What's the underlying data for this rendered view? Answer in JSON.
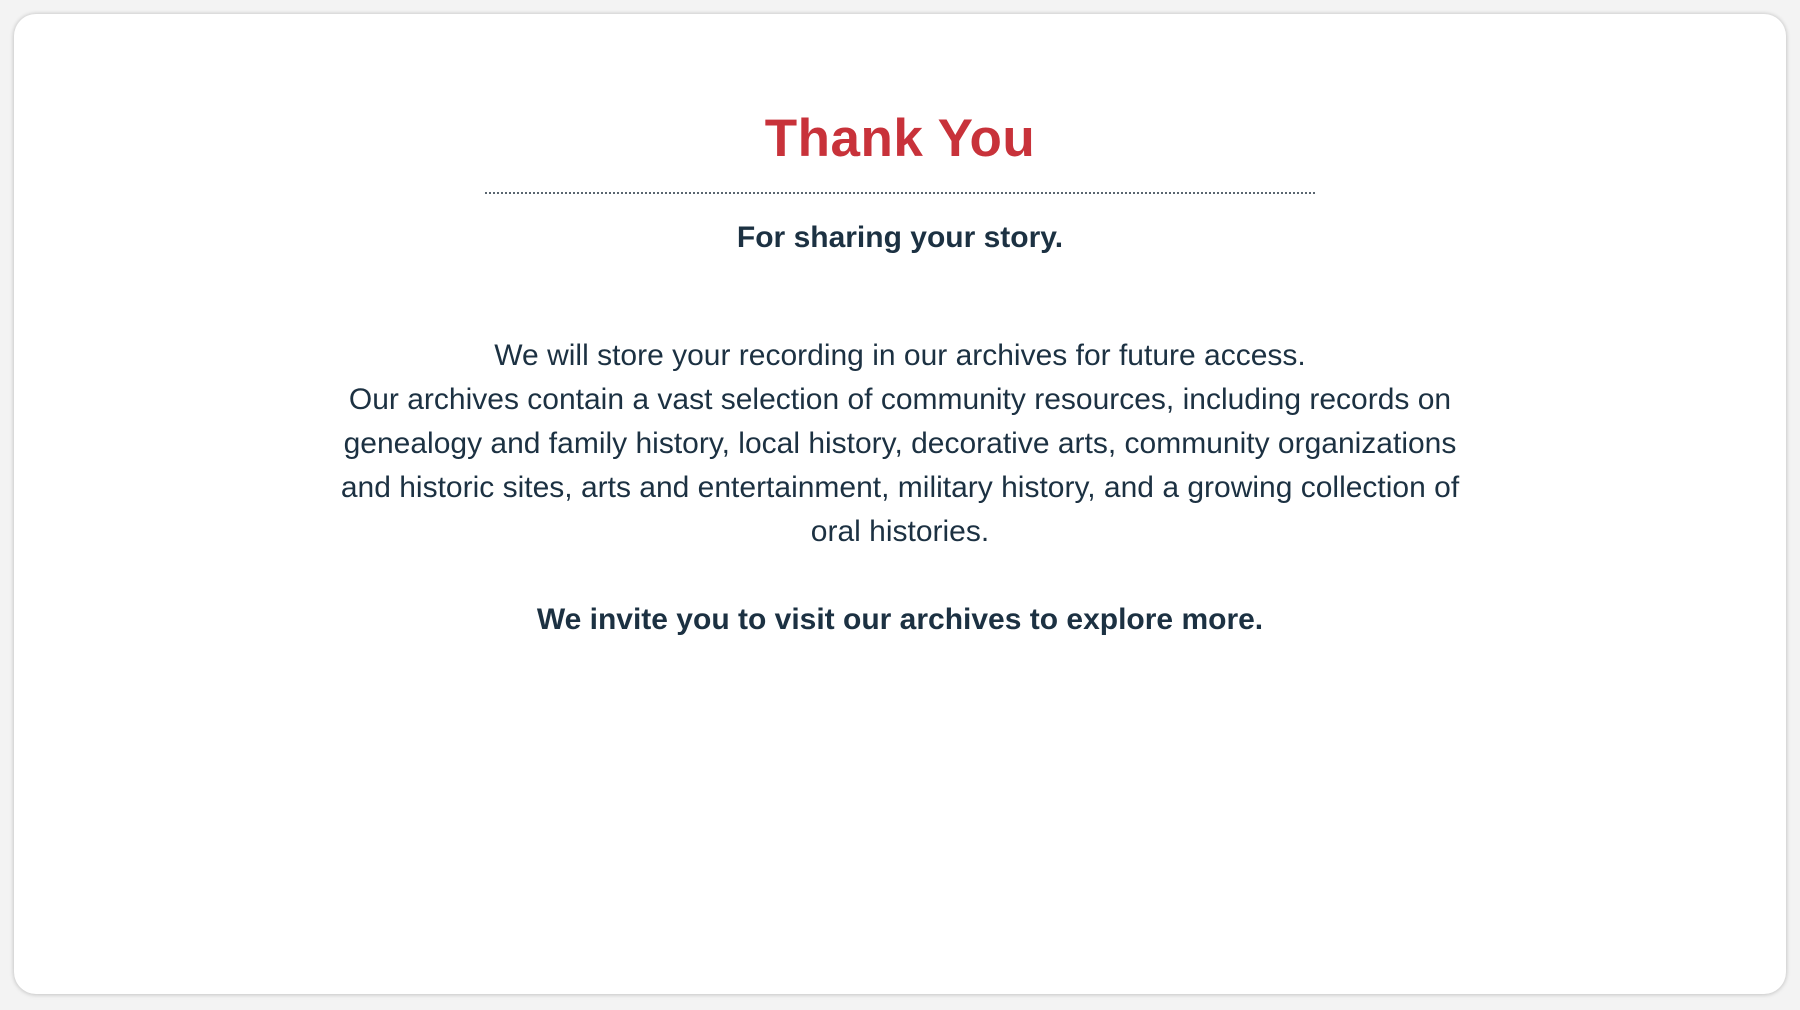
{
  "thank_you": {
    "title": "Thank You",
    "subtitle": "For sharing your story.",
    "body_line_1": "We will store your recording in our archives for future access.",
    "body_line_2": "Our archives contain a vast selection of community resources, including records on genealogy and family history, local history, decorative arts, community organizations and historic sites, arts and entertainment, military history, and a growing collection of oral histories.",
    "invite": "We invite you to visit our archives to explore more."
  },
  "colors": {
    "title": "#c8323a",
    "text": "#1c3142",
    "divider": "#5a6670",
    "background": "#ffffff"
  }
}
